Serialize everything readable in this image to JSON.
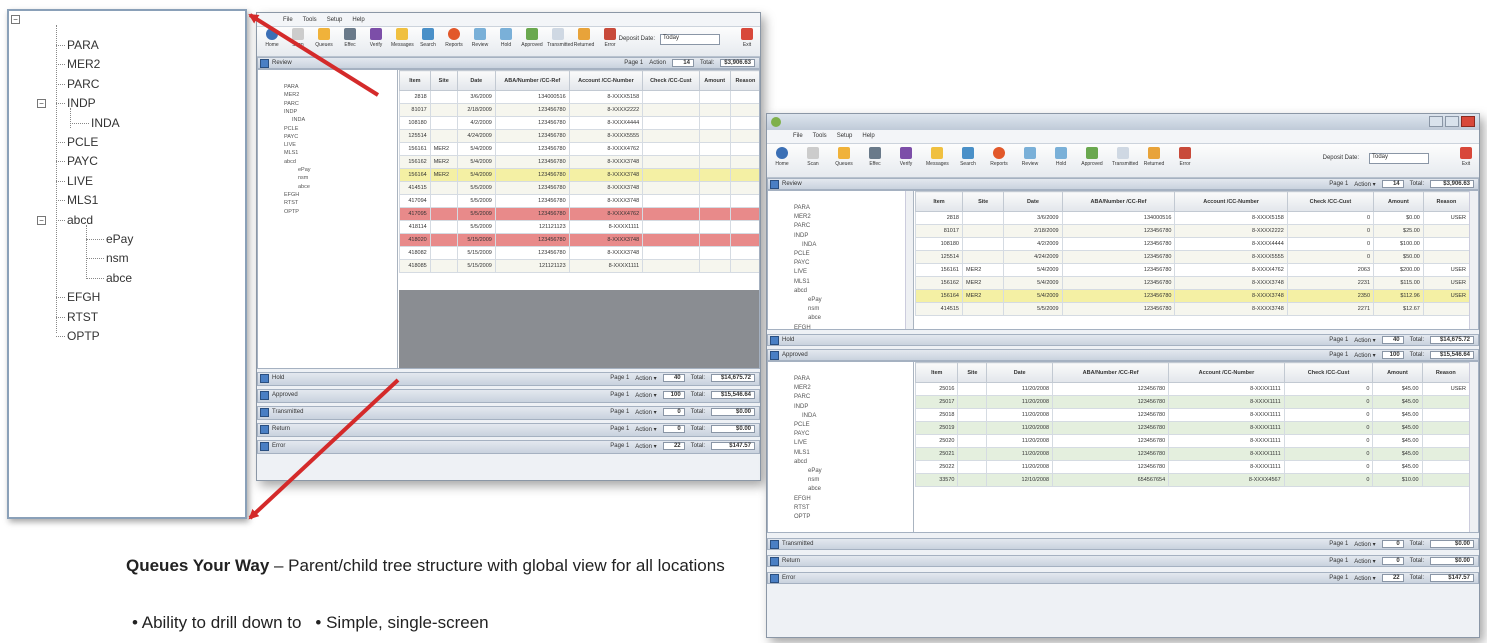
{
  "zoom_tree": {
    "root_toggle": "⊖",
    "nodes": [
      {
        "label": "PARA",
        "level": 1
      },
      {
        "label": "MER2",
        "level": 1
      },
      {
        "label": "PARC",
        "level": 1
      },
      {
        "label": "INDP",
        "level": 1,
        "toggle": "⊖"
      },
      {
        "label": "INDA",
        "level": 2
      },
      {
        "label": "PCLE",
        "level": 1
      },
      {
        "label": "PAYC",
        "level": 1
      },
      {
        "label": "LIVE",
        "level": 1
      },
      {
        "label": "MLS1",
        "level": 1
      },
      {
        "label": "abcd",
        "level": 1,
        "toggle": "⊖"
      },
      {
        "label": "ePay",
        "level": 2
      },
      {
        "label": "nsm",
        "level": 2
      },
      {
        "label": "abce",
        "level": 2
      },
      {
        "label": "EFGH",
        "level": 1
      },
      {
        "label": "RTST",
        "level": 1
      },
      {
        "label": "OPTP",
        "level": 1
      }
    ]
  },
  "menu": [
    "File",
    "Tools",
    "Setup",
    "Help"
  ],
  "toolbar": [
    "Home",
    "Scan",
    "Queues",
    "Effec",
    "Verify",
    "Messages",
    "Search",
    "Reports",
    "Review",
    "Hold",
    "Approved",
    "Transmitted",
    "Returned",
    "Error"
  ],
  "deposit_date": {
    "label": "Deposit Date:",
    "value": "Today"
  },
  "exit_label": "Exit",
  "queues": [
    {
      "name": "Review",
      "page": "Page 1",
      "action": "Action",
      "items": "14",
      "total_label": "Total:",
      "total": "$3,906.63"
    },
    {
      "name": "Hold",
      "page": "Page 1",
      "action": "Action",
      "items": "40",
      "total_label": "Total:",
      "total": "$14,675.72"
    },
    {
      "name": "Approved",
      "page": "Page 1",
      "action": "Action",
      "items": "100",
      "total_label": "Total:",
      "total": "$15,546.64"
    },
    {
      "name": "Transmitted",
      "page": "Page 1",
      "action": "Action",
      "items": "0",
      "total_label": "Total:",
      "total": "$0.00"
    },
    {
      "name": "Return",
      "page": "Page 1",
      "action": "Action",
      "items": "0",
      "total_label": "Total:",
      "total": "$0.00"
    },
    {
      "name": "Error",
      "page": "Page 1",
      "action": "Action",
      "items": "22",
      "total_label": "Total:",
      "total": "$147.57"
    }
  ],
  "grid_headers": [
    "Item",
    "Site",
    "Date",
    "ABA/Number /CC-Ref",
    "Account /CC-Number",
    "Check /CC-Cust",
    "Amount",
    "Reason"
  ],
  "review_rows": [
    {
      "item": "2818",
      "site": "",
      "date": "3/6/2009",
      "aba": "134000516",
      "acct": "8-XXXX5158",
      "check": "0",
      "amount": "$0.00",
      "reason": "USER",
      "hl": ""
    },
    {
      "item": "81017",
      "site": "",
      "date": "2/18/2009",
      "aba": "123456780",
      "acct": "8-XXXX2222",
      "check": "0",
      "amount": "$25.00",
      "reason": "",
      "hl": ""
    },
    {
      "item": "108180",
      "site": "",
      "date": "4/2/2009",
      "aba": "123456780",
      "acct": "8-XXXX4444",
      "check": "0",
      "amount": "$100.00",
      "reason": "",
      "hl": ""
    },
    {
      "item": "125514",
      "site": "",
      "date": "4/24/2009",
      "aba": "123456780",
      "acct": "8-XXXX5555",
      "check": "0",
      "amount": "$50.00",
      "reason": "",
      "hl": ""
    },
    {
      "item": "156161",
      "site": "MER2",
      "date": "5/4/2009",
      "aba": "123456780",
      "acct": "8-XXXX4762",
      "check": "2063",
      "amount": "$200.00",
      "reason": "USER",
      "hl": ""
    },
    {
      "item": "156162",
      "site": "MER2",
      "date": "5/4/2009",
      "aba": "123456780",
      "acct": "8-XXXX3748",
      "check": "2231",
      "amount": "$115.00",
      "reason": "USER",
      "hl": ""
    },
    {
      "item": "156164",
      "site": "MER2",
      "date": "5/4/2009",
      "aba": "123456780",
      "acct": "8-XXXX3748",
      "check": "2350",
      "amount": "$112.96",
      "reason": "USER",
      "hl": "yellow"
    },
    {
      "item": "414515",
      "site": "",
      "date": "5/5/2009",
      "aba": "123456780",
      "acct": "8-XXXX3748",
      "check": "2271",
      "amount": "$12.67",
      "reason": "",
      "hl": ""
    }
  ],
  "back_rows": [
    {
      "item": "2818",
      "site": "",
      "date": "3/6/2009",
      "aba": "134000516",
      "acct": "8-XXXX5158",
      "hl": ""
    },
    {
      "item": "81017",
      "site": "",
      "date": "2/18/2009",
      "aba": "123456780",
      "acct": "8-XXXX2222",
      "hl": ""
    },
    {
      "item": "108180",
      "site": "",
      "date": "4/2/2009",
      "aba": "123456780",
      "acct": "8-XXXX4444",
      "hl": ""
    },
    {
      "item": "125514",
      "site": "",
      "date": "4/24/2009",
      "aba": "123456780",
      "acct": "8-XXXX5555",
      "hl": ""
    },
    {
      "item": "156161",
      "site": "MER2",
      "date": "5/4/2009",
      "aba": "123456780",
      "acct": "8-XXXX4762",
      "hl": ""
    },
    {
      "item": "156162",
      "site": "MER2",
      "date": "5/4/2009",
      "aba": "123456780",
      "acct": "8-XXXX3748",
      "hl": ""
    },
    {
      "item": "156164",
      "site": "MER2",
      "date": "5/4/2009",
      "aba": "123456780",
      "acct": "8-XXXX3748",
      "hl": "yellow"
    },
    {
      "item": "414515",
      "site": "",
      "date": "5/5/2009",
      "aba": "123456780",
      "acct": "8-XXXX3748",
      "hl": ""
    },
    {
      "item": "417094",
      "site": "",
      "date": "5/5/2009",
      "aba": "123456780",
      "acct": "8-XXXX3748",
      "hl": ""
    },
    {
      "item": "417095",
      "site": "",
      "date": "5/5/2009",
      "aba": "123456780",
      "acct": "8-XXXX4762",
      "hl": "red"
    },
    {
      "item": "418114",
      "site": "",
      "date": "5/5/2009",
      "aba": "121121123",
      "acct": "8-XXXX1111",
      "hl": ""
    },
    {
      "item": "418020",
      "site": "",
      "date": "5/15/2009",
      "aba": "123456780",
      "acct": "8-XXXX3748",
      "hl": "red"
    },
    {
      "item": "418082",
      "site": "",
      "date": "5/15/2009",
      "aba": "123456780",
      "acct": "8-XXXX3748",
      "hl": ""
    },
    {
      "item": "418085",
      "site": "",
      "date": "5/15/2009",
      "aba": "121121123",
      "acct": "8-XXXX1111",
      "hl": ""
    }
  ],
  "approved_rows": [
    {
      "item": "25016",
      "date": "11/20/2008",
      "aba": "123456780",
      "acct": "8-XXXX1111",
      "check": "0",
      "amount": "$45.00",
      "reason": "USER"
    },
    {
      "item": "25017",
      "date": "11/20/2008",
      "aba": "123456780",
      "acct": "8-XXXX1111",
      "check": "0",
      "amount": "$45.00",
      "reason": ""
    },
    {
      "item": "25018",
      "date": "11/20/2008",
      "aba": "123456780",
      "acct": "8-XXXX1111",
      "check": "0",
      "amount": "$45.00",
      "reason": ""
    },
    {
      "item": "25019",
      "date": "11/20/2008",
      "aba": "123456780",
      "acct": "8-XXXX1111",
      "check": "0",
      "amount": "$45.00",
      "reason": ""
    },
    {
      "item": "25020",
      "date": "11/20/2008",
      "aba": "123456780",
      "acct": "8-XXXX1111",
      "check": "0",
      "amount": "$45.00",
      "reason": ""
    },
    {
      "item": "25021",
      "date": "11/20/2008",
      "aba": "123456780",
      "acct": "8-XXXX1111",
      "check": "0",
      "amount": "$45.00",
      "reason": ""
    },
    {
      "item": "25022",
      "date": "11/20/2008",
      "aba": "123456780",
      "acct": "8-XXXX1111",
      "check": "0",
      "amount": "$45.00",
      "reason": ""
    },
    {
      "item": "33570",
      "date": "12/10/2008",
      "aba": "654567654",
      "acct": "8-XXXX4567",
      "check": "0",
      "amount": "$10.00",
      "reason": ""
    }
  ],
  "mini_tree": [
    "PARA",
    "MER2",
    "PARC",
    "INDP",
    "INDA",
    "PCLE",
    "PAYC",
    "LIVE",
    "MLS1",
    "abcd",
    "ePay",
    "nsm",
    "abce",
    "EFGH",
    "RTST",
    "OPTP"
  ],
  "caption": {
    "bold": "Queues Your Way",
    "rest": " – Parent/child tree structure with global view for all locations"
  },
  "bullets": [
    "Ability to drill down to",
    "Simple, single-screen"
  ],
  "colors": {
    "arrow": "#d42a2a",
    "yellow": "#f4f0a4",
    "red": "#e88a8a",
    "green_row": "#e4efde"
  }
}
